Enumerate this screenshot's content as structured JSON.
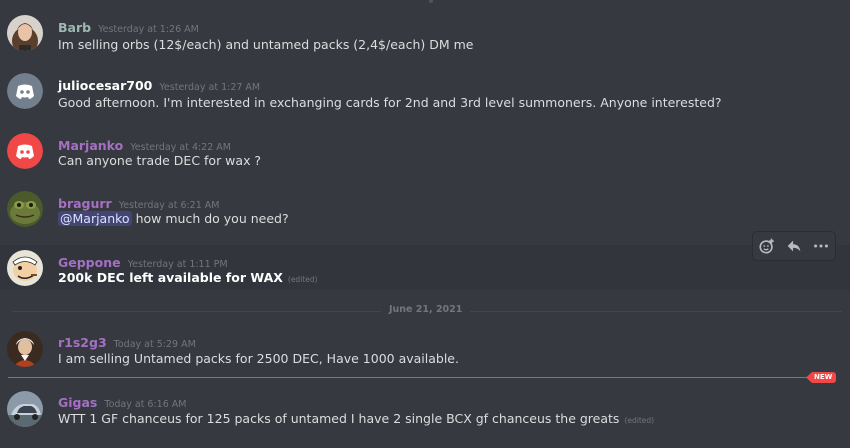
{
  "date_divider": "June 21, 2021",
  "new_badge": "NEW",
  "colors": {
    "background": "#36393f",
    "mention_bg": "#414675",
    "new_red": "#f04747",
    "timestamp": "#72767d"
  },
  "messages": [
    {
      "username": "Barb",
      "username_color": "#9eb8b1",
      "timestamp": "Yesterday at 1:26 AM",
      "text": "Im selling orbs (12$/each) and untamed packs (2,4$/each) DM me",
      "avatar": "photo-woman"
    },
    {
      "username": "juliocesar700",
      "username_color": "#ffffff",
      "timestamp": "Yesterday at 1:27 AM",
      "text": "Good afternoon. I'm interested in exchanging cards for 2nd and 3rd level summoners. Anyone interested?",
      "avatar": "discord-default-grey"
    },
    {
      "username": "Marjanko",
      "username_color": "#a570c4",
      "timestamp": "Yesterday at 4:22 AM",
      "text": "Can anyone trade DEC for wax ?",
      "avatar": "discord-default-red"
    },
    {
      "username": "bragurr",
      "username_color": "#a570c4",
      "timestamp": "Yesterday at 6:21 AM",
      "mention": "@Marjanko",
      "text": "how much do you need?",
      "avatar": "photo-frog"
    },
    {
      "username": "Geppone",
      "username_color": "#a570c4",
      "timestamp": "Yesterday at 1:11 PM",
      "text": "200k DEC left available for WAX",
      "edited": "(edited)",
      "avatar": "cartoon-popeye"
    },
    {
      "username": "r1s2g3",
      "username_color": "#a570c4",
      "timestamp": "Today at 5:29 AM",
      "text": "I am selling Untamed packs for 2500 DEC, Have 1000 available.",
      "avatar": "photo-portrait"
    },
    {
      "username": "Gigas",
      "username_color": "#a570c4",
      "timestamp": "Today at 6:16 AM",
      "text": "WTT 1 GF chanceus for 125 packs of untamed I have 2 single BCX gf chanceus the greats",
      "edited": "(edited)",
      "avatar": "photo-car"
    }
  ],
  "toolbar": {
    "icons": [
      "add-reaction-icon",
      "reply-icon",
      "more-icon"
    ]
  }
}
